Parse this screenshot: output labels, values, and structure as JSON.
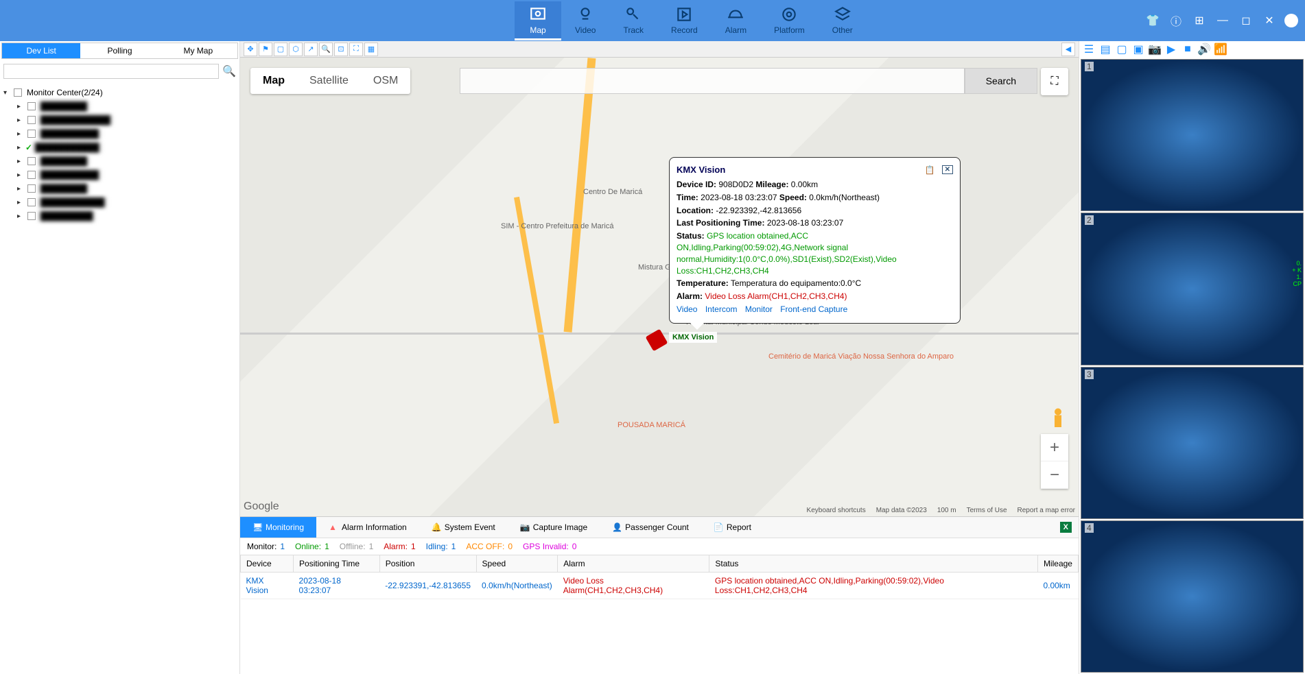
{
  "header": {
    "nav": [
      {
        "label": "Map",
        "active": true
      },
      {
        "label": "Video"
      },
      {
        "label": "Track"
      },
      {
        "label": "Record"
      },
      {
        "label": "Alarm"
      },
      {
        "label": "Platform"
      },
      {
        "label": "Other"
      }
    ]
  },
  "sidebar": {
    "tabs": [
      {
        "label": "Dev List",
        "active": true
      },
      {
        "label": "Polling"
      },
      {
        "label": "My Map"
      }
    ],
    "root_label": "Monitor Center(2/24)"
  },
  "map": {
    "type_tabs": [
      {
        "label": "Map",
        "active": true
      },
      {
        "label": "Satellite"
      },
      {
        "label": "OSM"
      }
    ],
    "search_btn": "Search",
    "logo": "Google",
    "attribution": {
      "shortcuts": "Keyboard shortcuts",
      "copyright": "Map data ©2023",
      "scale": "100 m",
      "terms": "Terms of Use",
      "report": "Report a map error"
    }
  },
  "vehicle": {
    "label": "KMX Vision"
  },
  "popup": {
    "title": "KMX Vision",
    "device_id_label": "Device ID:",
    "device_id": "908D0D2",
    "mileage_label": "Mileage:",
    "mileage": "0.00km",
    "time_label": "Time:",
    "time": "2023-08-18 03:23:07",
    "speed_label": "Speed:",
    "speed": "0.0km/h(Northeast)",
    "location_label": "Location:",
    "location": "-22.923392,-42.813656",
    "lastpos_label": "Last Positioning Time:",
    "lastpos": "2023-08-18 03:23:07",
    "status_label": "Status:",
    "status": "GPS location obtained,ACC ON,Idling,Parking(00:59:02),4G,Network signal normal,Humidity:1(0.0°C,0.0%),SD1(Exist),SD2(Exist),Video Loss:CH1,CH2,CH3,CH4",
    "temp_label": "Temperature:",
    "temp": "Temperatura do equipamento:0.0°C",
    "alarm_label": "Alarm:",
    "alarm": "Video Loss Alarm(CH1,CH2,CH3,CH4)",
    "links": [
      "Video",
      "Intercom",
      "Monitor",
      "Front-end Capture"
    ]
  },
  "bottom": {
    "tabs": [
      {
        "label": "Monitoring",
        "active": true,
        "icon_color": "#fff"
      },
      {
        "label": "Alarm Information",
        "icon_color": "#f66"
      },
      {
        "label": "System Event",
        "icon_color": "#5c5"
      },
      {
        "label": "Capture Image",
        "icon_color": "#5cc"
      },
      {
        "label": "Passenger Count",
        "icon_color": "#5c5"
      },
      {
        "label": "Report",
        "icon_color": "#5c5"
      }
    ],
    "status": [
      {
        "label": "Monitor:",
        "value": "1",
        "cls": "sv-blue"
      },
      {
        "label": "Online:",
        "value": "1",
        "cls": "sv-green"
      },
      {
        "label": "Offline:",
        "value": "1",
        "cls": "sv-gray"
      },
      {
        "label": "Alarm:",
        "value": "1",
        "cls": "sv-red"
      },
      {
        "label": "Idling:",
        "value": "1",
        "cls": "sv-blue"
      },
      {
        "label": "ACC OFF:",
        "value": "0",
        "cls": "sv-orange"
      },
      {
        "label": "GPS Invalid:",
        "value": "0",
        "cls": "sv-pink"
      }
    ],
    "columns": [
      "Device",
      "Positioning Time",
      "Position",
      "Speed",
      "Alarm",
      "Status",
      "Mileage"
    ],
    "row": {
      "device": "KMX Vision",
      "time": "2023-08-18 03:23:07",
      "position": "-22.923391,-42.813655",
      "speed": "0.0km/h(Northeast)",
      "alarm": "Video Loss Alarm(CH1,CH2,CH3,CH4)",
      "status": "GPS location obtained,ACC ON,Idling,Parking(00:59:02),Video Loss:CH1,CH2,CH3,CH4",
      "mileage": "0.00km"
    }
  },
  "video_cells": [
    "1",
    "2",
    "3",
    "4"
  ],
  "map_labels": {
    "l1": "SIM - Centro\nPrefeitura de Maricá",
    "l2": "Centro De Maricá",
    "l3": "Mistura Grill Maricá\n- Bar, Pizzaria e...",
    "l4": "Hospital Municipal\nConde Modesto Leal",
    "l5": "Cemitério de Maricá\nViação Nossa\nSenhora do Amparo",
    "l6": "POUSADA MARICÁ"
  }
}
